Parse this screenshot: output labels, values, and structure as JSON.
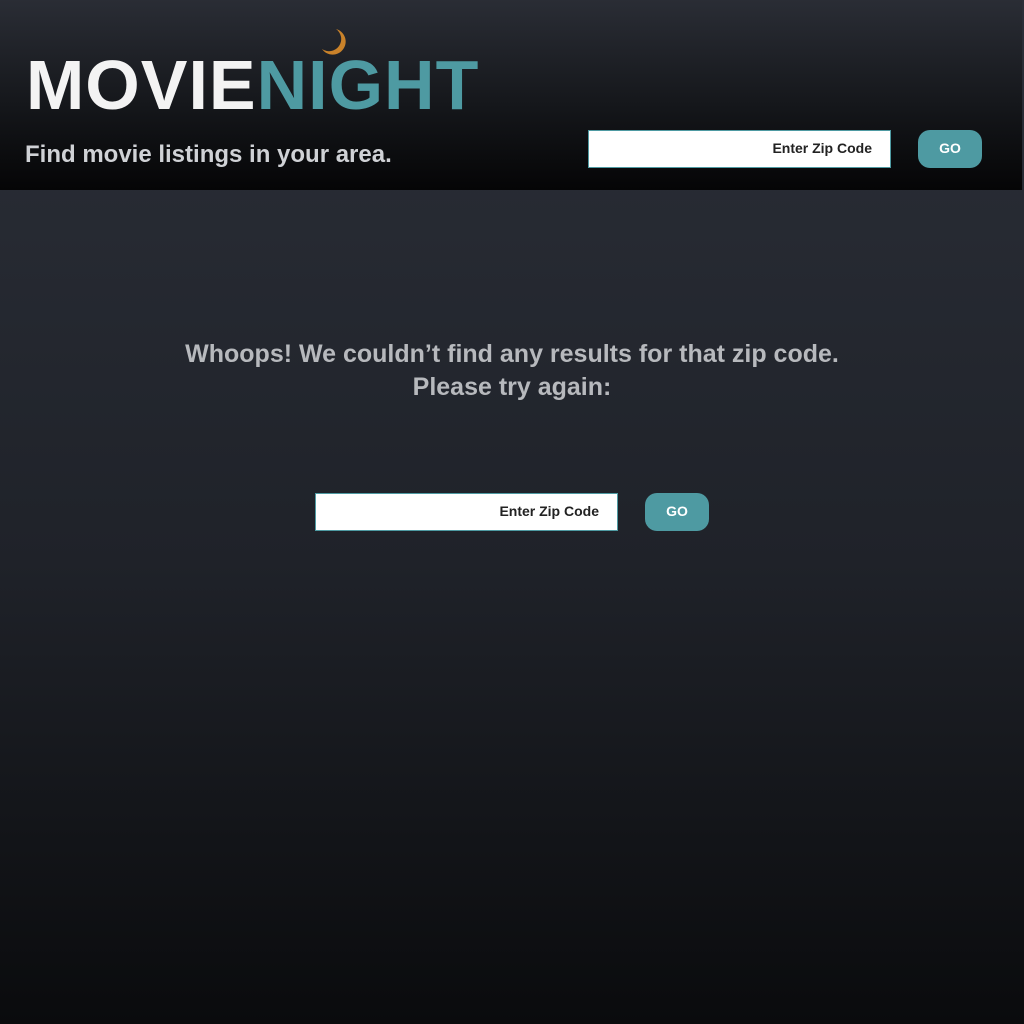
{
  "header": {
    "logo_part1": "MOVIE",
    "logo_part2": "NIGHT",
    "logo_icon": "crescent-moon-icon",
    "tagline": "Find movie listings in your area.",
    "search": {
      "placeholder": "Enter Zip Code",
      "value": "",
      "button_label": "GO"
    }
  },
  "main": {
    "message_line1": "Whoops! We couldn’t find any results for that zip code.",
    "message_line2": "Please try again:",
    "search": {
      "placeholder": "Enter Zip Code",
      "value": "",
      "button_label": "GO"
    }
  },
  "colors": {
    "accent": "#4e9aa2",
    "moon": "#c9822a",
    "logo_white": "#f3f3f3",
    "message_text": "#b7b9bd"
  }
}
